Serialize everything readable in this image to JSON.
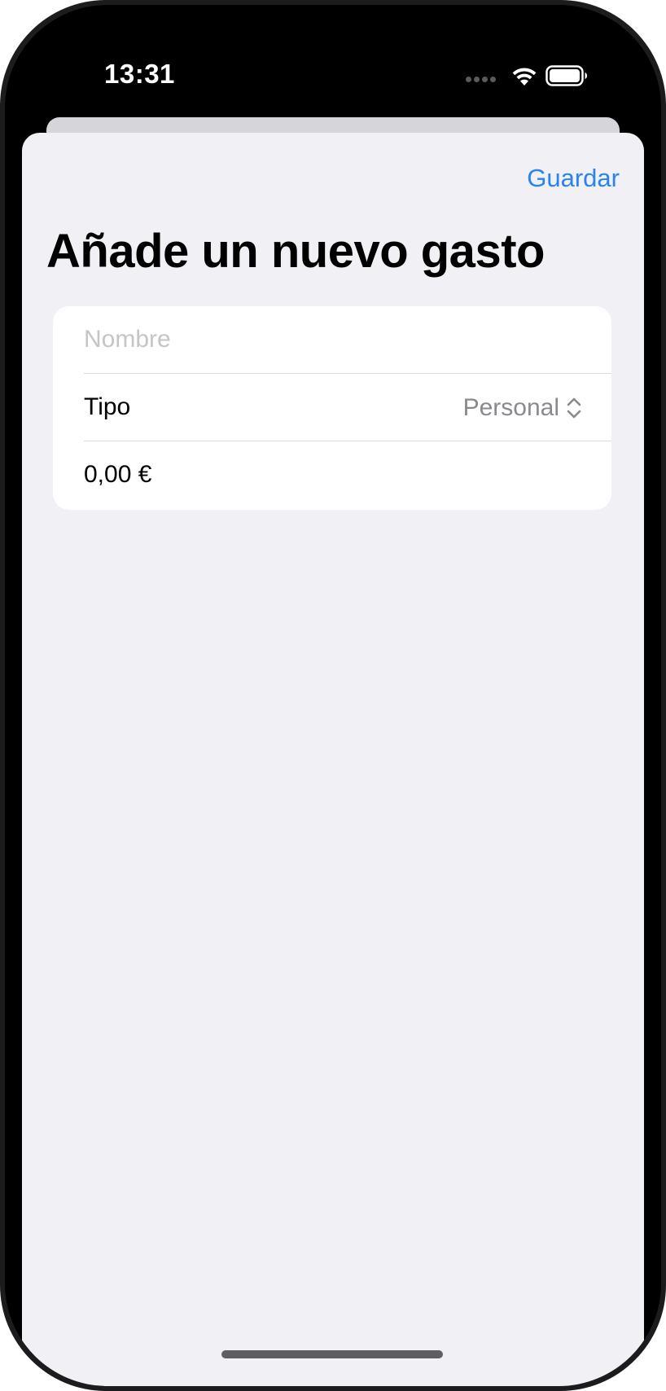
{
  "status_bar": {
    "time": "13:31",
    "icons": [
      "signal-dots-icon",
      "wifi-icon",
      "battery-icon"
    ]
  },
  "nav": {
    "save_label": "Guardar"
  },
  "page": {
    "title": "Añade un nuevo gasto"
  },
  "form": {
    "name": {
      "placeholder": "Nombre",
      "value": ""
    },
    "type": {
      "label": "Tipo",
      "selected": "Personal"
    },
    "amount": {
      "value": "0,00 €"
    }
  },
  "colors": {
    "accent": "#2a83f0",
    "sheet_background": "#f0f0f5",
    "card_background": "#ffffff",
    "secondary_text": "#8a8a8e",
    "placeholder_text": "#c5c5c9"
  }
}
